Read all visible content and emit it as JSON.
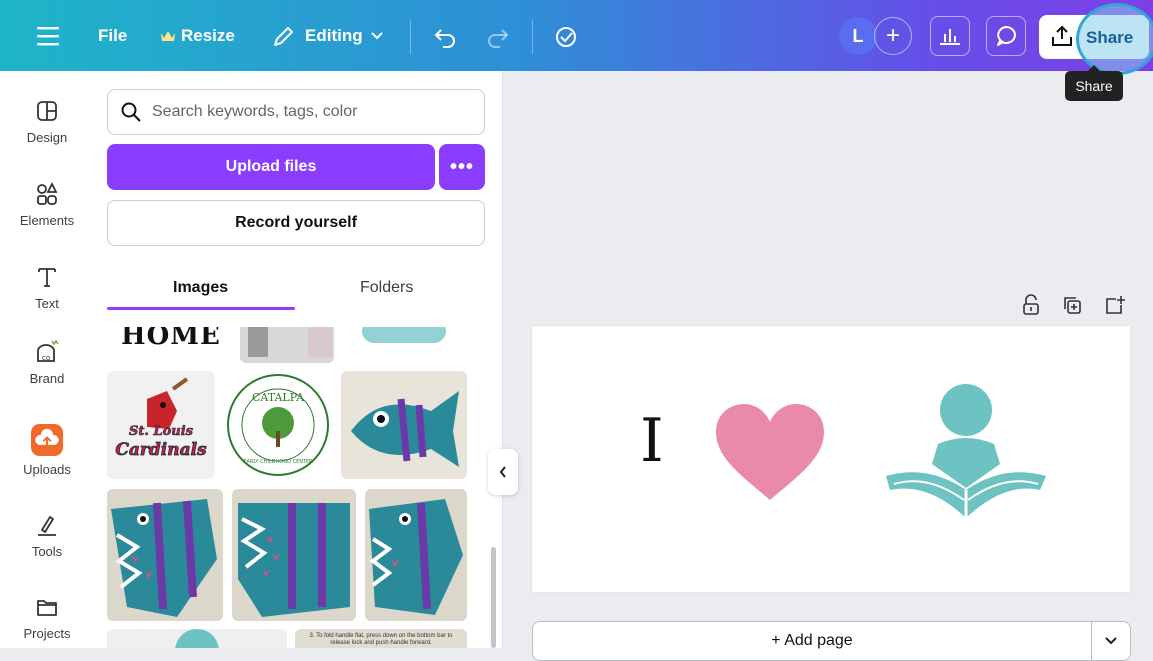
{
  "topbar": {
    "menu_icon": "hamburger-icon",
    "file_label": "File",
    "resize_label": "Resize",
    "editing_label": "Editing",
    "avatar_initial": "L",
    "share_label": "Share",
    "share_tooltip": "Share",
    "colors": {
      "gradient_start": "#1fb5c8",
      "gradient_end": "#7f3ee6"
    }
  },
  "sidebar": {
    "items": [
      {
        "label": "Design",
        "icon": "design-icon"
      },
      {
        "label": "Elements",
        "icon": "elements-icon"
      },
      {
        "label": "Text",
        "icon": "text-icon"
      },
      {
        "label": "Brand",
        "icon": "brand-icon"
      },
      {
        "label": "Uploads",
        "icon": "upload-cloud-icon"
      },
      {
        "label": "Tools",
        "icon": "tools-icon"
      },
      {
        "label": "Projects",
        "icon": "folder-icon"
      }
    ]
  },
  "panel": {
    "search_placeholder": "Search keywords, tags, color",
    "upload_label": "Upload files",
    "upload_more_label": "•••",
    "record_label": "Record yourself",
    "tabs": [
      "Images",
      "Folders"
    ],
    "active_tab": "Images",
    "thumb_text": {
      "home": "HOME",
      "cardinals_top": "St. Louis",
      "cardinals_bottom": "Cardinals",
      "catalpa": "CATALPA",
      "catalpa_sub": "EARLY CHILDHOOD CENTER",
      "instructions": "3. To fold handle flat, press down on the bottom bar to release lock and push handle forward."
    }
  },
  "canvas": {
    "page_text": "I",
    "add_page_label": "+ Add page",
    "colors": {
      "accent": "#8b3dff",
      "heart": "#e98aa8",
      "reader": "#6cc3c1"
    }
  }
}
